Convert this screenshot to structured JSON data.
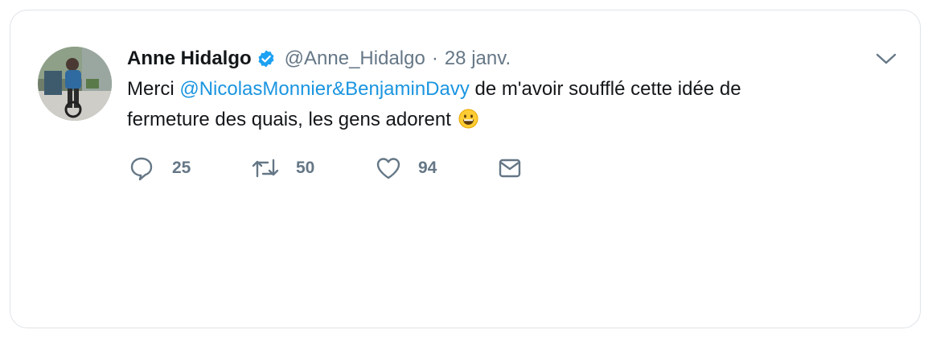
{
  "tweet": {
    "display_name": "Anne Hidalgo",
    "handle": "@Anne_Hidalgo",
    "separator": "·",
    "date": "28 janv.",
    "text_before": "Merci ",
    "mention": "@NicolasMonnier&BenjaminDavy",
    "text_line1_after": " de m'avoir soufflé cette idée de",
    "text_line2": "fermeture des quais, les gens adorent",
    "emoji": "grinning-face-emoji"
  },
  "actions": {
    "replies": "25",
    "retweets": "50",
    "likes": "94"
  },
  "icons": {
    "verified": "verified-badge-icon",
    "caret": "chevron-down-icon",
    "reply": "reply-icon",
    "retweet": "retweet-icon",
    "like": "heart-icon",
    "dm": "envelope-icon"
  },
  "colors": {
    "text": "#14171a",
    "secondary": "#657786",
    "link": "#1b95e0",
    "verified": "#1da1f2",
    "border": "#dfe3e8"
  }
}
